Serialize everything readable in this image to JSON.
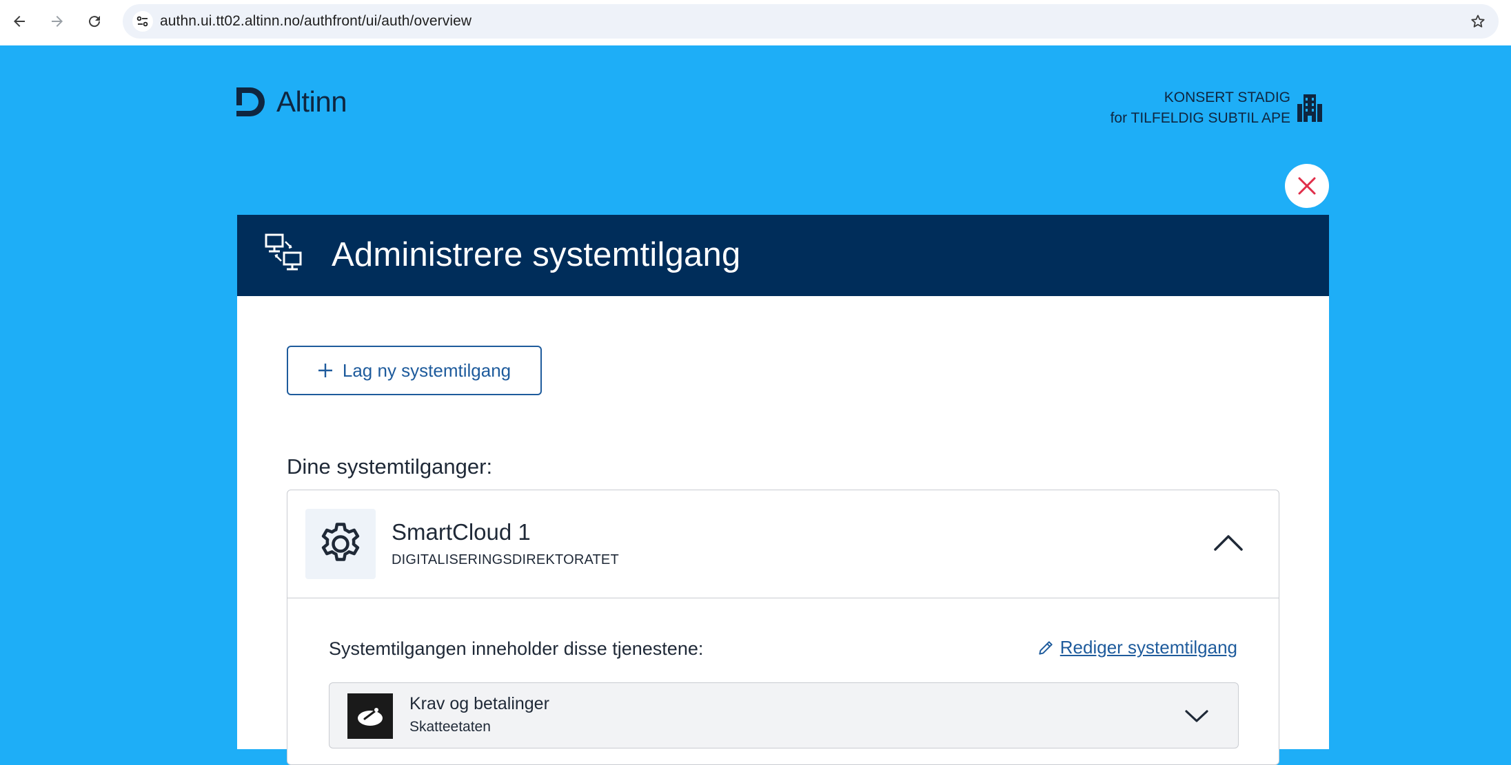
{
  "browser": {
    "url": "authn.ui.tt02.altinn.no/authfront/ui/auth/overview",
    "icons": [
      "back-arrow-icon",
      "forward-arrow-icon",
      "reload-icon",
      "site-settings-icon",
      "bookmark-star-icon"
    ]
  },
  "header": {
    "logo_text": "Altinn",
    "org_name": "KONSERT STADIG",
    "acting_for": "for TILFELDIG SUBTIL APE"
  },
  "panel": {
    "title": "Administrere systemtilgang",
    "new_button_label": "Lag ny systemtilgang",
    "section_title": "Dine systemtilganger:"
  },
  "system": {
    "name": "SmartCloud 1",
    "vendor": "DIGITALISERINGSDIREKTORATET",
    "expanded": true,
    "services_title": "Systemtilgangen inneholder disse tjenestene:",
    "edit_link": "Rediger systemtilgang",
    "services": [
      {
        "name": "Krav og betalinger",
        "owner": "Skatteetaten"
      }
    ]
  },
  "colors": {
    "page_bg": "#1eaef7",
    "panel_header": "#002d5a",
    "link": "#1e5b9c",
    "close_x": "#e02e49"
  }
}
